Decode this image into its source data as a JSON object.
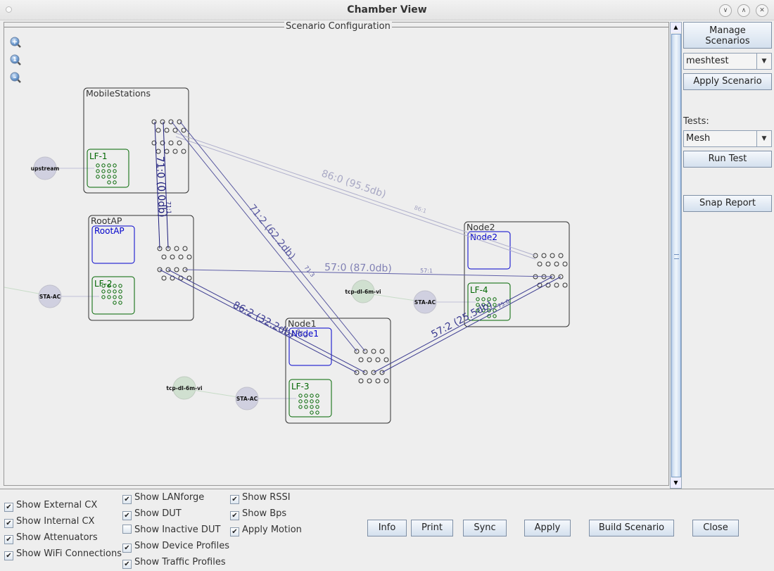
{
  "window": {
    "title": "Chamber View"
  },
  "canvas": {
    "legend": "Scenario Configuration",
    "zoom_controls": [
      "zoom-in",
      "zoom-reset",
      "zoom-out"
    ],
    "groups": [
      {
        "id": "MobileStations",
        "label": "MobileStations",
        "inner": [
          {
            "label": "LF-1",
            "kind": "lanforge"
          }
        ]
      },
      {
        "id": "RootAP",
        "label": "RootAP",
        "inner": [
          {
            "label": "RootAP",
            "kind": "dut"
          },
          {
            "label": "LF-2",
            "kind": "lanforge"
          }
        ]
      },
      {
        "id": "Node2",
        "label": "Node2",
        "inner": [
          {
            "label": "Node2",
            "kind": "dut"
          },
          {
            "label": "LF-4",
            "kind": "lanforge"
          }
        ]
      },
      {
        "id": "Node1",
        "label": "Node1",
        "inner": [
          {
            "label": "Node1",
            "kind": "dut"
          },
          {
            "label": "LF-3",
            "kind": "lanforge"
          }
        ]
      }
    ],
    "profiles": [
      {
        "label": "upstream",
        "kind": "device"
      },
      {
        "label": "STA-AC",
        "kind": "device"
      },
      {
        "label": "STA-AC",
        "kind": "device"
      },
      {
        "label": "STA-AC",
        "kind": "device"
      },
      {
        "label": "tcp-dl-6m-vi",
        "kind": "traffic"
      },
      {
        "label": "tcp-dl-6m-vi",
        "kind": "traffic"
      }
    ],
    "links": [
      {
        "label": "71:0 (0.0db)",
        "sub": "71:1"
      },
      {
        "label": "86:0 (95.5db)",
        "sub": "86:1"
      },
      {
        "label": "71:2 (62.2db)",
        "sub": "71:3"
      },
      {
        "label": "57:0 (87.0db)",
        "sub": "57:1"
      },
      {
        "label": "86:2 (32.2db)",
        "sub": "86:3"
      },
      {
        "label": "57:2 (25.5db)",
        "sub": "75:0"
      }
    ]
  },
  "sidebar": {
    "manage_scenarios": "Manage Scenarios",
    "manage_line1": "Manage",
    "manage_line2": "Scenarios",
    "scenario_value": "meshtest",
    "apply_scenario": "Apply Scenario",
    "tests_label": "Tests:",
    "tests_value": "Mesh",
    "run_test": "Run Test",
    "snap_report": "Snap Report"
  },
  "options": {
    "col1": [
      {
        "label": "Show External CX",
        "checked": true
      },
      {
        "label": "Show Internal CX",
        "checked": true
      },
      {
        "label": "Show Attenuators",
        "checked": true
      },
      {
        "label": "Show WiFi Connections",
        "checked": true
      }
    ],
    "col2": [
      {
        "label": "Show LANforge",
        "checked": true
      },
      {
        "label": "Show DUT",
        "checked": true
      },
      {
        "label": "Show Inactive DUT",
        "checked": false
      },
      {
        "label": "Show Device Profiles",
        "checked": true
      },
      {
        "label": "Show Traffic Profiles",
        "checked": true
      }
    ],
    "col3": [
      {
        "label": "Show RSSI",
        "checked": true
      },
      {
        "label": "Show Bps",
        "checked": true
      },
      {
        "label": "Apply Motion",
        "checked": true
      }
    ]
  },
  "buttons": {
    "info": "Info",
    "print": "Print",
    "sync": "Sync",
    "apply": "Apply",
    "build_scenario": "Build Scenario",
    "close": "Close"
  },
  "colors": {
    "dut": "#0000cc",
    "lanforge": "#006600",
    "link": "#3c3c8c",
    "device_profile": "#d0d0e0",
    "traffic_profile": "#d0e0d0"
  }
}
